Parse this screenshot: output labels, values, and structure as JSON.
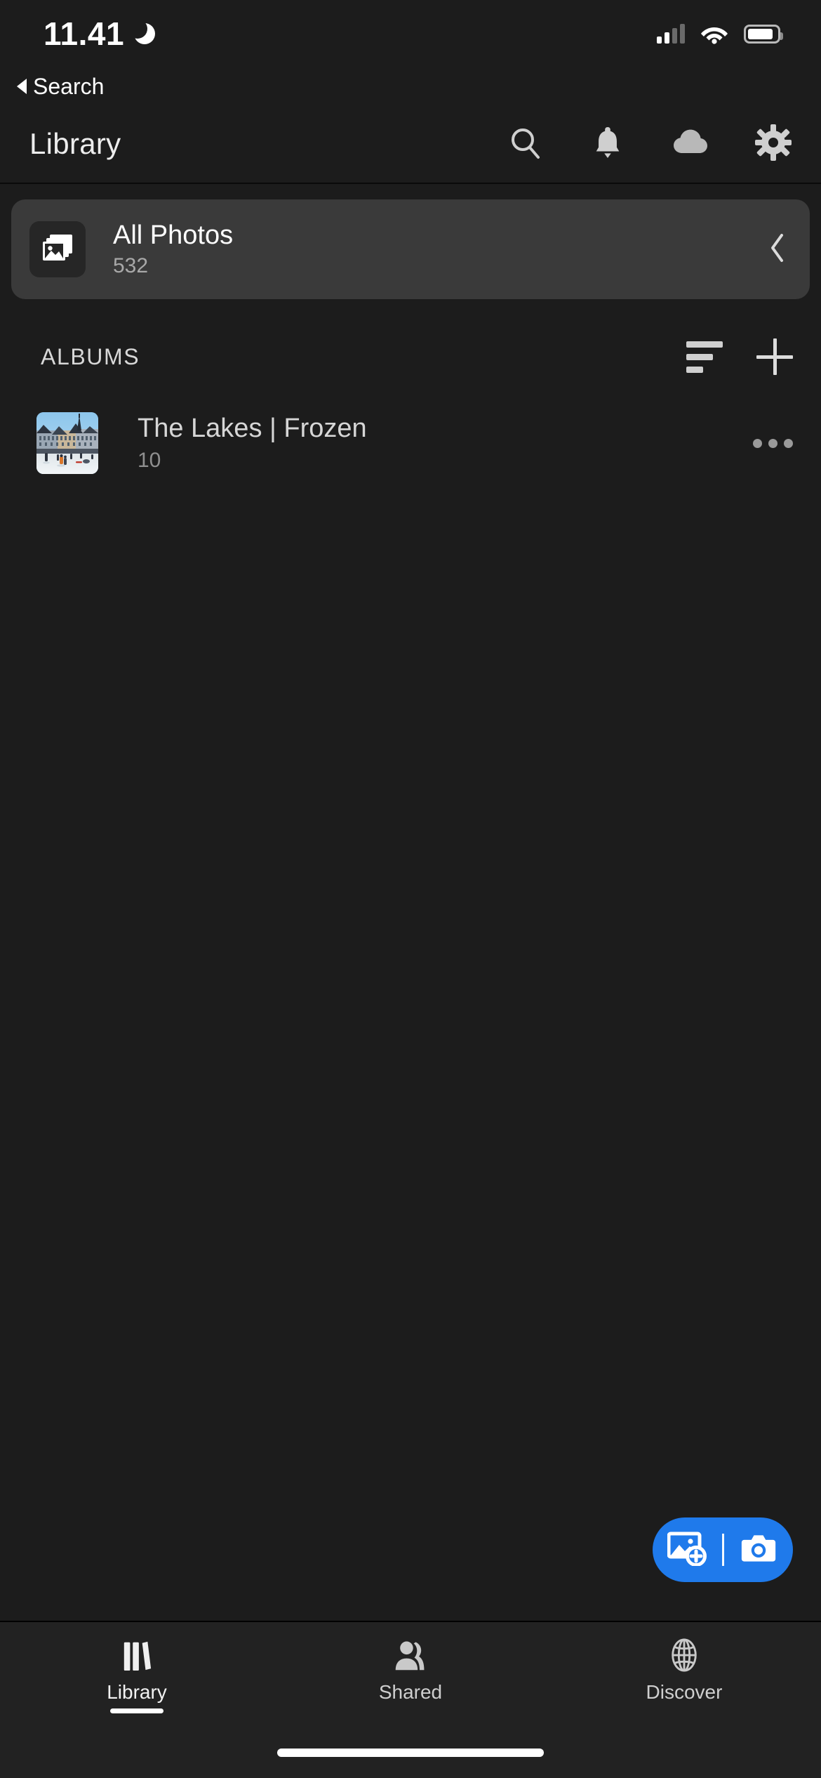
{
  "status_bar": {
    "time": "11.41",
    "dnd_icon": "crescent-moon-icon",
    "signal_icon": "cellular-signal-icon",
    "signal_bars_filled": 2,
    "signal_bars_total": 4,
    "wifi_icon": "wifi-icon",
    "battery_icon": "battery-icon",
    "battery_level": 88
  },
  "back_link": {
    "label": "Search",
    "icon": "back-triangle-icon"
  },
  "app_bar": {
    "title": "Library",
    "actions": [
      {
        "name": "search-icon",
        "label": "Search"
      },
      {
        "name": "bell-icon",
        "label": "Notifications"
      },
      {
        "name": "cloud-icon",
        "label": "Cloud Sync"
      },
      {
        "name": "gear-icon",
        "label": "Settings"
      }
    ]
  },
  "all_photos": {
    "title": "All Photos",
    "count": "532",
    "icon": "photo-stack-icon",
    "chevron": "chevron-left-icon"
  },
  "albums_section": {
    "label": "ALBUMS",
    "sort_icon": "sort-icon",
    "add_icon": "plus-icon",
    "albums": [
      {
        "name": "The Lakes | Frozen",
        "count": "10",
        "thumbnail": "winter-ice-skating-plaza",
        "more_icon": "more-horizontal-icon"
      }
    ]
  },
  "fab": {
    "add_photo_icon": "add-photo-icon",
    "camera_icon": "camera-icon",
    "color": "#1f7aeb"
  },
  "bottom_nav": {
    "items": [
      {
        "label": "Library",
        "icon": "books-icon",
        "active": true
      },
      {
        "label": "Shared",
        "icon": "people-icon",
        "active": false
      },
      {
        "label": "Discover",
        "icon": "globe-icon",
        "active": false
      }
    ]
  },
  "colors": {
    "background": "#1c1c1c",
    "card": "#3a3a3a",
    "nav_background": "#222222",
    "accent": "#1f7aeb",
    "text_primary": "#ffffff",
    "text_secondary": "#a8a8a8"
  }
}
